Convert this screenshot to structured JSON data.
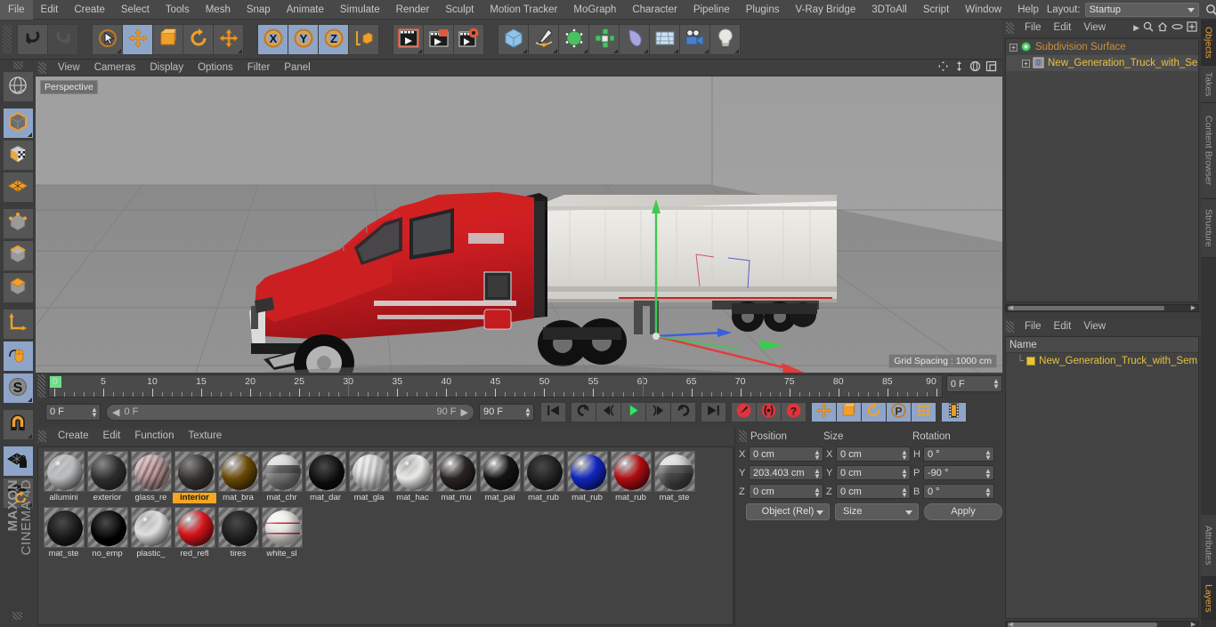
{
  "app": {
    "title": "Cinema 4D",
    "brand_top": "MAXON",
    "brand_bottom": "CINEMA 4D"
  },
  "menubar": {
    "items": [
      "File",
      "Edit",
      "Create",
      "Select",
      "Tools",
      "Mesh",
      "Snap",
      "Animate",
      "Simulate",
      "Render",
      "Sculpt",
      "Motion Tracker",
      "MoGraph",
      "Character",
      "Pipeline",
      "Plugins",
      "V-Ray Bridge",
      "3DToAll",
      "Script",
      "Window",
      "Help"
    ],
    "layout_label": "Layout:",
    "layout_value": "Startup",
    "search_icon": "search-icon"
  },
  "toolbar": {
    "groups": [
      {
        "name": "history",
        "buttons": [
          {
            "name": "undo-button",
            "icon": "undo-icon",
            "active": false,
            "disabled": false,
            "corner": false
          },
          {
            "name": "redo-button",
            "icon": "redo-icon",
            "active": false,
            "disabled": true,
            "corner": false
          }
        ]
      },
      {
        "name": "transform",
        "buttons": [
          {
            "name": "select-tool-button",
            "icon": "live-selection-icon",
            "active": false,
            "disabled": false,
            "corner": true
          },
          {
            "name": "move-tool-button",
            "icon": "move-icon",
            "active": true,
            "disabled": false,
            "corner": false
          },
          {
            "name": "scale-tool-button",
            "icon": "scale-icon",
            "active": false,
            "disabled": false,
            "corner": false
          },
          {
            "name": "rotate-tool-button",
            "icon": "rotate-icon",
            "active": false,
            "disabled": false,
            "corner": false
          },
          {
            "name": "free-move-button",
            "icon": "move-icon",
            "active": false,
            "disabled": false,
            "corner": true
          }
        ]
      },
      {
        "name": "axis-lock",
        "buttons": [
          {
            "name": "x-axis-button",
            "icon": "x-axis-icon",
            "active": true,
            "disabled": false,
            "corner": false
          },
          {
            "name": "y-axis-button",
            "icon": "y-axis-icon",
            "active": true,
            "disabled": false,
            "corner": false
          },
          {
            "name": "z-axis-button",
            "icon": "z-axis-icon",
            "active": true,
            "disabled": false,
            "corner": false
          },
          {
            "name": "world-coordinates-button",
            "icon": "world-axis-icon",
            "active": false,
            "disabled": false,
            "corner": false
          }
        ]
      },
      {
        "name": "render",
        "buttons": [
          {
            "name": "render-view-button",
            "icon": "render-view-icon",
            "active": false,
            "disabled": false,
            "corner": true
          },
          {
            "name": "render-to-picture-viewer-button",
            "icon": "render-picture-icon",
            "active": false,
            "disabled": false,
            "corner": false
          },
          {
            "name": "render-settings-button",
            "icon": "render-settings-icon",
            "active": false,
            "disabled": false,
            "corner": false
          }
        ]
      },
      {
        "name": "objects",
        "buttons": [
          {
            "name": "add-cube-button",
            "icon": "cube-icon",
            "active": false,
            "disabled": false,
            "corner": true
          },
          {
            "name": "add-spline-button",
            "icon": "pen-spline-icon",
            "active": false,
            "disabled": false,
            "corner": true
          },
          {
            "name": "add-generator-button",
            "icon": "generator-icon",
            "active": false,
            "disabled": false,
            "corner": true
          },
          {
            "name": "add-array-button",
            "icon": "array-icon",
            "active": false,
            "disabled": false,
            "corner": true
          },
          {
            "name": "add-deformer-button",
            "icon": "bend-deformer-icon",
            "active": false,
            "disabled": false,
            "corner": true
          },
          {
            "name": "add-floor-button",
            "icon": "floor-icon",
            "active": false,
            "disabled": false,
            "corner": true
          },
          {
            "name": "add-camera-button",
            "icon": "camera-icon",
            "active": false,
            "disabled": false,
            "corner": true
          },
          {
            "name": "add-light-button",
            "icon": "light-bulb-icon",
            "active": false,
            "disabled": false,
            "corner": true
          }
        ]
      }
    ]
  },
  "left_rail": {
    "buttons": [
      {
        "name": "world-grid-button",
        "icon": "globe-grid-icon",
        "active": false,
        "corner": false
      },
      {
        "name": "model-mode-button",
        "icon": "model-cube-icon",
        "active": true,
        "corner": true
      },
      {
        "name": "texture-mode-button",
        "icon": "texture-cube-icon",
        "active": false,
        "corner": false
      },
      {
        "name": "workplane-button",
        "icon": "workplane-grid-icon",
        "active": false,
        "corner": false
      },
      {
        "name": "points-mode-button",
        "icon": "points-cube-icon",
        "active": false,
        "corner": false
      },
      {
        "name": "edges-mode-button",
        "icon": "edges-cube-icon",
        "active": false,
        "corner": false
      },
      {
        "name": "polygons-mode-button",
        "icon": "polygons-cube-icon",
        "active": false,
        "corner": false
      },
      {
        "name": "object-axis-button",
        "icon": "axis-corner-icon",
        "active": false,
        "corner": false
      },
      {
        "name": "enable-axis-modification-button",
        "icon": "mouse-axis-icon",
        "active": true,
        "corner": false
      },
      {
        "name": "snap-button",
        "icon": "snap-s-icon",
        "active": true,
        "corner": true
      },
      {
        "name": "magnet-button",
        "icon": "magnet-icon",
        "active": false,
        "corner": true
      },
      {
        "name": "workplane-lock-button",
        "icon": "workplane-lock-icon",
        "active": true,
        "corner": false
      },
      {
        "name": "planar-workplane-button",
        "icon": "workplane-rotate-icon",
        "active": false,
        "corner": true
      }
    ]
  },
  "viewport": {
    "menu": [
      "View",
      "Cameras",
      "Display",
      "Options",
      "Filter",
      "Panel"
    ],
    "label": "Perspective",
    "grid_spacing": "Grid Spacing : 1000 cm",
    "corner_icons": [
      "pan-icon",
      "dolly-icon",
      "orbit-icon",
      "maximize-icon"
    ],
    "scene": {
      "model": "New Generation Truck with Semi Trailer",
      "truck_cab_color": "#cf1f22",
      "trailer_color": "#e8e6e2",
      "ground_color": "#8d8d8d",
      "sky_color": "#a3a3a3",
      "axis_x_color": "#e23c3c",
      "axis_y_color": "#3ec94f",
      "axis_z_color": "#3b5fe0"
    }
  },
  "timeline": {
    "ticks": [
      "0",
      "5",
      "10",
      "15",
      "20",
      "25",
      "30",
      "35",
      "40",
      "45",
      "50",
      "55",
      "60",
      "65",
      "70",
      "75",
      "80",
      "85",
      "90"
    ],
    "current_frame": "0 F",
    "range_start": "0 F",
    "range_end": "90 F",
    "max_frame": "90 F",
    "frame_right": "0 F",
    "transport": [
      {
        "name": "go-to-start-button",
        "icon": "skip-start-icon",
        "active": false
      },
      {
        "name": "play-backwards-button",
        "icon": "reverse-loop-icon",
        "active": false
      },
      {
        "name": "previous-frame-button",
        "icon": "step-back-icon",
        "active": false
      },
      {
        "name": "play-button",
        "icon": "play-icon",
        "active": false
      },
      {
        "name": "next-frame-button",
        "icon": "step-forward-icon",
        "active": false
      },
      {
        "name": "play-forwards-button",
        "icon": "forward-loop-icon",
        "active": false
      },
      {
        "name": "go-to-end-button",
        "icon": "skip-end-icon",
        "active": false
      },
      {
        "name": "record-active-objects-button",
        "icon": "record-key-icon",
        "active": false
      },
      {
        "name": "autokeying-button",
        "icon": "autokey-icon",
        "active": false
      },
      {
        "name": "keyframe-selection-button",
        "icon": "question-key-icon",
        "active": false
      },
      {
        "name": "position-key-button",
        "icon": "move-icon",
        "active": true
      },
      {
        "name": "scale-key-button",
        "icon": "scale-icon",
        "active": true
      },
      {
        "name": "rotation-key-button",
        "icon": "rotate-icon",
        "active": true
      },
      {
        "name": "parameter-key-button",
        "icon": "parameter-p-icon",
        "active": true
      },
      {
        "name": "point-level-animation-button",
        "icon": "pla-dots-icon",
        "active": true
      },
      {
        "name": "timeline-button",
        "icon": "filmstrip-icon",
        "active": true
      }
    ]
  },
  "materials": {
    "menu": [
      "Create",
      "Edit",
      "Function",
      "Texture"
    ],
    "selected": "interior",
    "items": [
      {
        "name": "allumini",
        "color": "#b9bcbe",
        "type": "metal"
      },
      {
        "name": "exterior",
        "color": "#2c2c2e",
        "type": "complex"
      },
      {
        "name": "glass_re",
        "color": "#c9a6a6",
        "type": "striped"
      },
      {
        "name": "interior",
        "color": "#312e2c",
        "type": "complex"
      },
      {
        "name": "mat_bra",
        "color": "#6a4a06",
        "type": "glossy"
      },
      {
        "name": "mat_chr",
        "color": "#7c7c7e",
        "type": "chrome"
      },
      {
        "name": "mat_dar",
        "color": "#0a0a0a",
        "type": "matte"
      },
      {
        "name": "mat_gla",
        "color": "#d6d6d6",
        "type": "glass"
      },
      {
        "name": "mat_hac",
        "color": "#e9e9e6",
        "type": "glossy"
      },
      {
        "name": "mat_mu",
        "color": "#2a2523",
        "type": "glossy"
      },
      {
        "name": "mat_pai",
        "color": "#141414",
        "type": "glossy"
      },
      {
        "name": "mat_rub",
        "color": "#191919",
        "type": "matte"
      },
      {
        "name": "mat_rub",
        "color": "#1026c0",
        "type": "glossy"
      },
      {
        "name": "mat_rub",
        "color": "#b20d12",
        "type": "glossy"
      },
      {
        "name": "mat_ste",
        "color": "#4a4744",
        "type": "chrome"
      },
      {
        "name": "mat_ste",
        "color": "#131313",
        "type": "matte"
      },
      {
        "name": "no_emp",
        "color": "#000000",
        "type": "matte"
      },
      {
        "name": "plastic_",
        "color": "#dedede",
        "type": "glossy"
      },
      {
        "name": "red_refl",
        "color": "#d4151b",
        "type": "glossy"
      },
      {
        "name": "tires",
        "color": "#1b1a1a",
        "type": "matte"
      },
      {
        "name": "white_sl",
        "color": "#ebebe8",
        "type": "striped-red"
      }
    ]
  },
  "coordinates": {
    "headers": [
      "Position",
      "Size",
      "Rotation"
    ],
    "position": {
      "x_label": "X",
      "x": "0 cm",
      "y_label": "Y",
      "y": "203.403 cm",
      "z_label": "Z",
      "z": "0 cm"
    },
    "size": {
      "x_label": "X",
      "x": "0 cm",
      "y_label": "Y",
      "y": "0 cm",
      "z_label": "Z",
      "z": "0 cm"
    },
    "rotation": {
      "h_label": "H",
      "h": "0 °",
      "p_label": "P",
      "p": "-90 °",
      "b_label": "B",
      "b": "0 °"
    },
    "mode_left": "Object (Rel)",
    "mode_mid": "Size",
    "apply": "Apply"
  },
  "object_manager": {
    "menu": [
      "File",
      "Edit",
      "View"
    ],
    "icons": [
      "search-icon",
      "home-icon",
      "ellipse-icon",
      "frame-icon"
    ],
    "rows": [
      {
        "label": "Subdivision Surface",
        "color": "#c9913f",
        "icon": "subdivision-surface-icon",
        "depth": 0
      },
      {
        "label": "New_Generation_Truck_with_Ser",
        "color": "#e8c33d",
        "icon": "null-object-icon",
        "depth": 1
      }
    ]
  },
  "attribute_manager": {
    "menu": [
      "File",
      "Edit",
      "View"
    ],
    "column_header": "Name",
    "rows": [
      {
        "label": "New_Generation_Truck_with_Sem",
        "color": "#e8c33d",
        "icon": "layer-swatch-icon"
      }
    ]
  },
  "vtabs_top": [
    "Objects",
    "Takes",
    "Content Browser",
    "Structure"
  ],
  "vtabs_bottom": [
    "Attributes",
    "Layers"
  ],
  "vtab_active_top": "Objects",
  "vtab_active_bottom": "Layers"
}
